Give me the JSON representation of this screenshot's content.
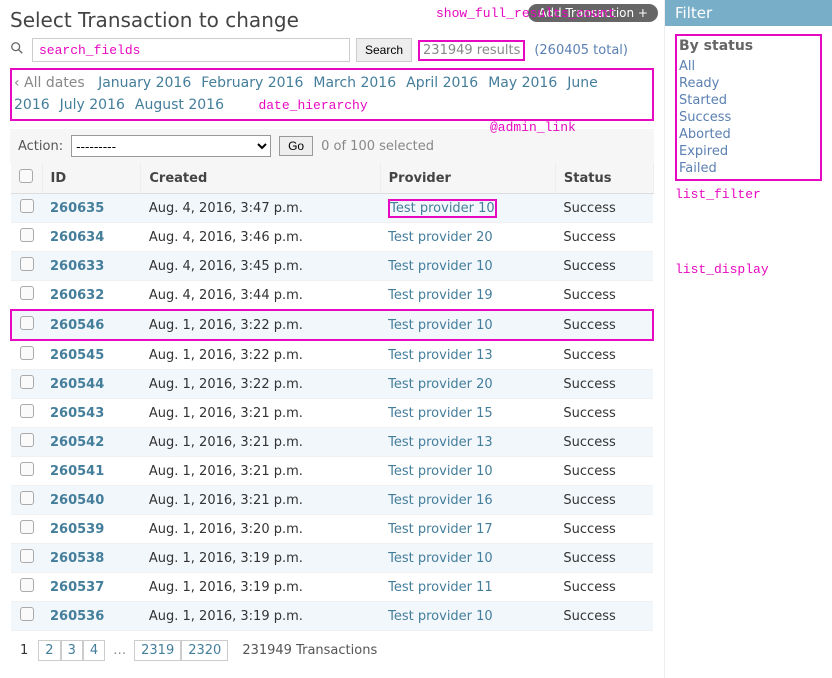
{
  "header": {
    "title": "Select Transaction to change",
    "add_button": "Add Transaction +"
  },
  "annotations": {
    "show_full_results_count": "show_full_results_count",
    "search_fields": "search_fields",
    "date_hierarchy": "date_hierarchy",
    "admin_link": "@admin_link",
    "list_filter": "list_filter",
    "list_display": "list_display"
  },
  "search": {
    "button": "Search",
    "results": "231949 results",
    "total": "(260405 total)"
  },
  "date_hierarchy": {
    "back": "‹ All dates",
    "months": [
      "January 2016",
      "February 2016",
      "March 2016",
      "April 2016",
      "May 2016",
      "June 2016",
      "July 2016",
      "August 2016"
    ]
  },
  "actions": {
    "label": "Action:",
    "placeholder": "---------",
    "go": "Go",
    "selected": "0 of 100 selected"
  },
  "columns": [
    "ID",
    "Created",
    "Provider",
    "Status"
  ],
  "rows": [
    {
      "id": "260635",
      "created": "Aug. 4, 2016, 3:47 p.m.",
      "provider": "Test provider 10",
      "status": "Success"
    },
    {
      "id": "260634",
      "created": "Aug. 4, 2016, 3:46 p.m.",
      "provider": "Test provider 20",
      "status": "Success"
    },
    {
      "id": "260633",
      "created": "Aug. 4, 2016, 3:45 p.m.",
      "provider": "Test provider 10",
      "status": "Success"
    },
    {
      "id": "260632",
      "created": "Aug. 4, 2016, 3:44 p.m.",
      "provider": "Test provider 19",
      "status": "Success"
    },
    {
      "id": "260546",
      "created": "Aug. 1, 2016, 3:22 p.m.",
      "provider": "Test provider 10",
      "status": "Success"
    },
    {
      "id": "260545",
      "created": "Aug. 1, 2016, 3:22 p.m.",
      "provider": "Test provider 13",
      "status": "Success"
    },
    {
      "id": "260544",
      "created": "Aug. 1, 2016, 3:22 p.m.",
      "provider": "Test provider 20",
      "status": "Success"
    },
    {
      "id": "260543",
      "created": "Aug. 1, 2016, 3:21 p.m.",
      "provider": "Test provider 15",
      "status": "Success"
    },
    {
      "id": "260542",
      "created": "Aug. 1, 2016, 3:21 p.m.",
      "provider": "Test provider 13",
      "status": "Success"
    },
    {
      "id": "260541",
      "created": "Aug. 1, 2016, 3:21 p.m.",
      "provider": "Test provider 10",
      "status": "Success"
    },
    {
      "id": "260540",
      "created": "Aug. 1, 2016, 3:21 p.m.",
      "provider": "Test provider 16",
      "status": "Success"
    },
    {
      "id": "260539",
      "created": "Aug. 1, 2016, 3:20 p.m.",
      "provider": "Test provider 17",
      "status": "Success"
    },
    {
      "id": "260538",
      "created": "Aug. 1, 2016, 3:19 p.m.",
      "provider": "Test provider 10",
      "status": "Success"
    },
    {
      "id": "260537",
      "created": "Aug. 1, 2016, 3:19 p.m.",
      "provider": "Test provider 11",
      "status": "Success"
    },
    {
      "id": "260536",
      "created": "Aug. 1, 2016, 3:19 p.m.",
      "provider": "Test provider 10",
      "status": "Success"
    }
  ],
  "pager": {
    "current": "1",
    "pages": [
      "2",
      "3",
      "4"
    ],
    "last_pages": [
      "2319",
      "2320"
    ],
    "dots": "…",
    "count": "231949 Transactions"
  },
  "filter": {
    "title": "Filter",
    "group_title": "By status",
    "options": [
      "All",
      "Ready",
      "Started",
      "Success",
      "Aborted",
      "Expired",
      "Failed"
    ]
  }
}
